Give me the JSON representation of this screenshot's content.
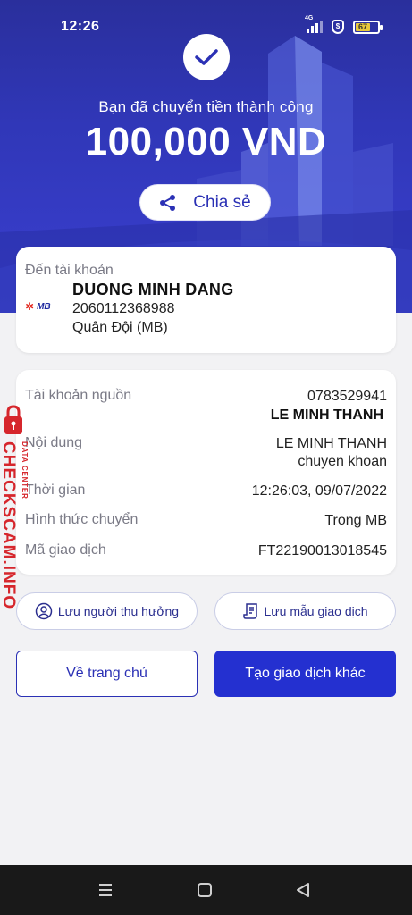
{
  "status_bar": {
    "time": "12:26",
    "network": "4G",
    "battery": "67"
  },
  "hero": {
    "success_text": "Bạn đã chuyển tiền thành công",
    "amount": "100,000 VND",
    "share_label": "Chia sẻ"
  },
  "recipient": {
    "label": "Đến tài khoản",
    "bank_logo_text": "MB",
    "name": "DUONG MINH DANG",
    "account": "2060112368988",
    "bank": "Quân Đội (MB)"
  },
  "details": {
    "source": {
      "label": "Tài khoản nguồn",
      "account": "0783529941",
      "name": "LE MINH THANH"
    },
    "content": {
      "label": "Nội dung",
      "line1": "LE MINH THANH",
      "line2": "chuyen khoan"
    },
    "time": {
      "label": "Thời gian",
      "value": "12:26:03, 09/07/2022"
    },
    "method": {
      "label": "Hình thức chuyển",
      "value": "Trong MB"
    },
    "txn": {
      "label": "Mã giao dịch",
      "value": "FT22190013018545"
    }
  },
  "actions": {
    "save_recipient": "Lưu người thụ hưởng",
    "save_template": "Lưu mẫu giao dịch",
    "home": "Về trang chủ",
    "new_txn": "Tạo giao dịch khác"
  },
  "watermark": {
    "brand": "CHECKSCAM.INFO",
    "sub": "DATA CENTER"
  },
  "colors": {
    "primary": "#2430d0",
    "hero": "#3037b8",
    "watermark": "#d6262c"
  },
  "icons": [
    "check-icon",
    "share-icon",
    "user-circle-icon",
    "receipt-icon",
    "menu-icon",
    "home-square-icon",
    "back-triangle-icon",
    "lock-icon"
  ]
}
